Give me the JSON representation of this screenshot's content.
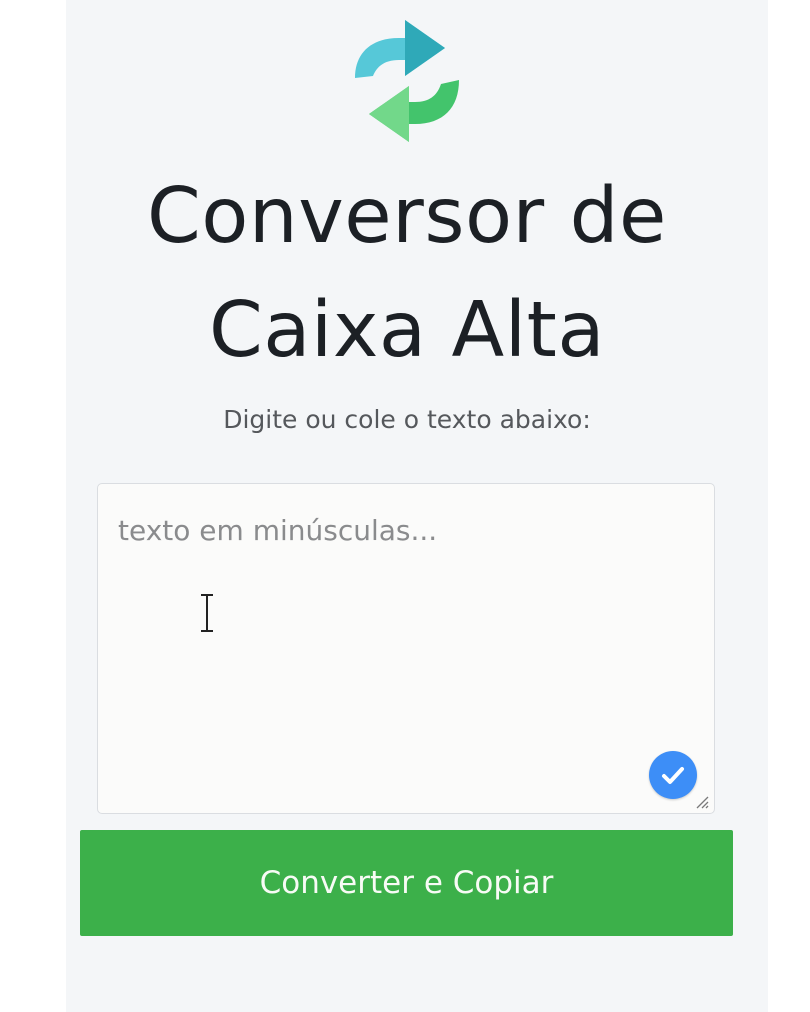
{
  "app": {
    "title_line1": "Conversor de",
    "title_line2": "Caixa Alta",
    "subtitle": "Digite ou cole o texto abaixo:"
  },
  "editor": {
    "value": "",
    "placeholder": "texto em minúsculas...",
    "badge_icon": "check-icon",
    "cursor_icon": "text-cursor-icon"
  },
  "actions": {
    "convert_label": "Converter e Copiar"
  },
  "icons": {
    "logo": "convert-arrows-icon"
  },
  "colors": {
    "background": "#f4f6f8",
    "button": "#3cb04a",
    "badge": "#3d8ef7",
    "logo_teal": "#4fc7d6",
    "logo_green": "#3fbf6a"
  }
}
